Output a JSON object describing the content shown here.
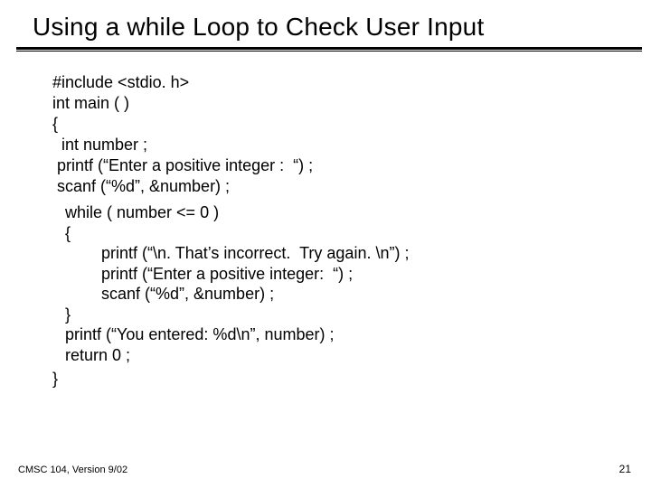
{
  "title": "Using  a while Loop to Check User Input",
  "code": {
    "l1": "#include <stdio. h>",
    "l2": "int main ( )",
    "l3": "{",
    "l4": "  int number ;",
    "l5": " printf (“Enter a positive integer :  “) ;",
    "l6": " scanf (“%d”, &number) ;",
    "l7": "while ( number <= 0 )",
    "l8": "{",
    "l9": "        printf (“\\n. That’s incorrect.  Try again. \\n”) ;",
    "l10": "        printf (“Enter a positive integer:  “) ;",
    "l11": "        scanf (“%d”, &number) ;",
    "l12": "}",
    "l13": "printf (“You entered: %d\\n”, number) ;",
    "l14": "return 0 ;",
    "l15": "}"
  },
  "footer": {
    "left": "CMSC 104, Version 9/02",
    "right": "21"
  }
}
